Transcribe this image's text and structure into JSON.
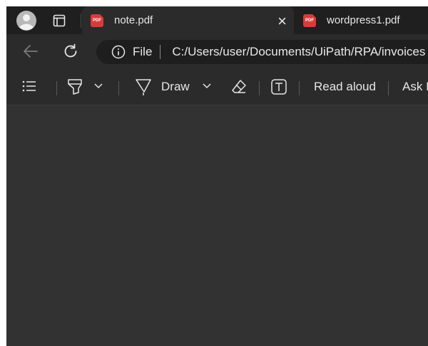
{
  "tabs": [
    {
      "title": "note.pdf",
      "active": true,
      "close": "×"
    },
    {
      "title": "wordpress1.pdf",
      "active": false
    }
  ],
  "pdf_badge": "PDF",
  "address": {
    "scheme_label": "File",
    "url": "C:/Users/user/Documents/UiPath/RPA/invoices"
  },
  "toolbar": {
    "draw_label": "Draw",
    "read_aloud_label": "Read aloud",
    "ask_label": "Ask I"
  },
  "icons": {
    "profile": "avatar-icon",
    "tab_actions": "tab-actions-icon",
    "back": "back-arrow-icon",
    "refresh": "refresh-icon",
    "info": "info-icon",
    "contents": "list-icon",
    "highlight": "highlighter-icon",
    "draw": "pen-icon",
    "erase": "eraser-icon",
    "text": "text-box-icon",
    "chevron": "chevron-down-icon"
  }
}
